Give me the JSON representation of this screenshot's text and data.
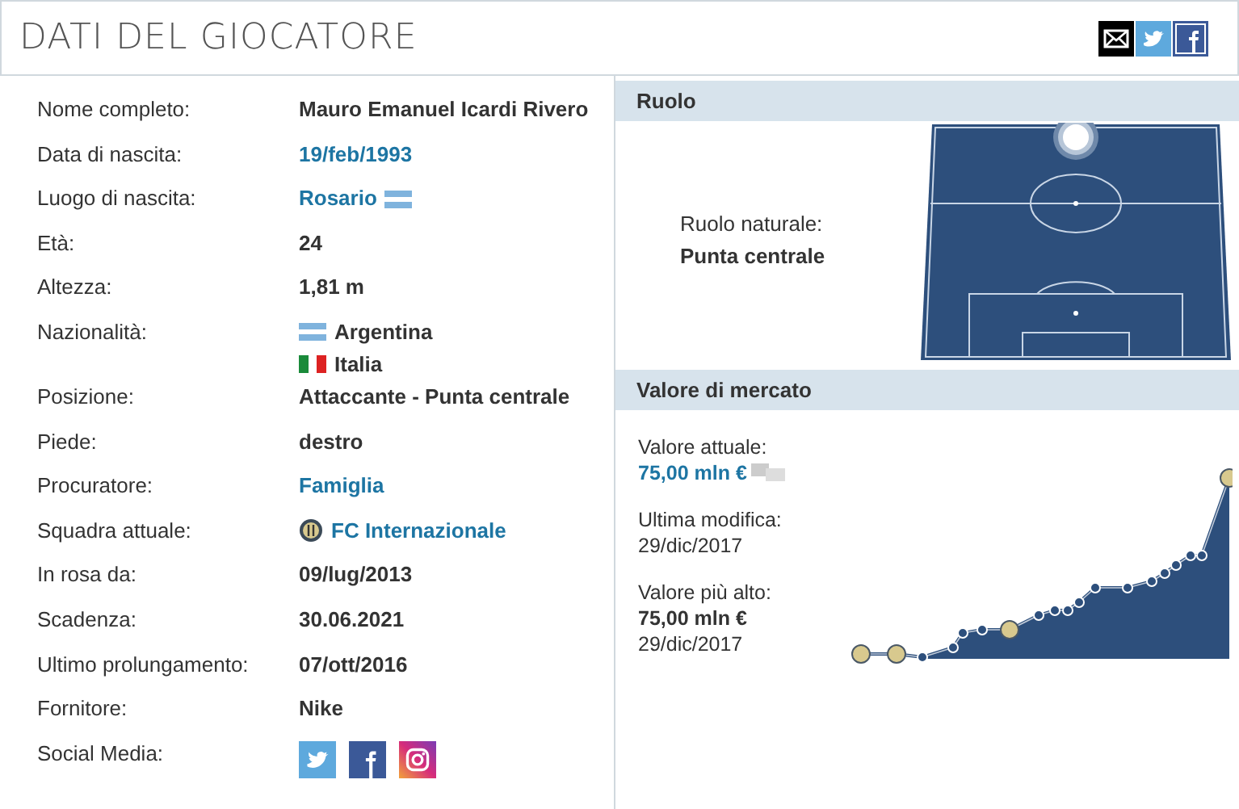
{
  "title": "DATI DEL GIOCATORE",
  "rows": [
    {
      "label": "Nome completo:",
      "values": [
        {
          "text": "Mauro Emanuel Icardi Rivero",
          "kind": "text"
        }
      ]
    },
    {
      "label": "Data di nascita:",
      "values": [
        {
          "text": "19/feb/1993",
          "kind": "link"
        }
      ]
    },
    {
      "label": "Luogo di nascita:",
      "values": [
        {
          "text": "Rosario",
          "kind": "link"
        }
      ]
    },
    {
      "label": "Età:",
      "values": [
        {
          "text": "24",
          "kind": "text"
        }
      ]
    },
    {
      "label": "Altezza:",
      "values": [
        {
          "text": "1,81 m",
          "kind": "text"
        }
      ]
    },
    {
      "label": "Nazionalità:",
      "values": [
        {
          "text": "Argentina",
          "kind": "text"
        },
        {
          "text": "Italia",
          "kind": "text"
        }
      ]
    },
    {
      "label": "Posizione:",
      "values": [
        {
          "text": "Attaccante - Punta centrale",
          "kind": "text"
        }
      ]
    },
    {
      "label": "Piede:",
      "values": [
        {
          "text": "destro",
          "kind": "text"
        }
      ]
    },
    {
      "label": "Procuratore:",
      "values": [
        {
          "text": "Famiglia",
          "kind": "link"
        }
      ]
    },
    {
      "label": "Squadra attuale:",
      "values": [
        {
          "text": "FC Internazionale",
          "kind": "link"
        }
      ]
    },
    {
      "label": "In rosa da:",
      "values": [
        {
          "text": "09/lug/2013",
          "kind": "text"
        }
      ]
    },
    {
      "label": "Scadenza:",
      "values": [
        {
          "text": "30.06.2021",
          "kind": "text"
        }
      ]
    },
    {
      "label": "Ultimo prolungamento:",
      "values": [
        {
          "text": "07/ott/2016",
          "kind": "text"
        }
      ]
    },
    {
      "label": "Fornitore:",
      "values": [
        {
          "text": "Nike",
          "kind": "text"
        }
      ]
    },
    {
      "label": "Social Media:",
      "values": [
        {
          "kind": "social"
        }
      ]
    }
  ],
  "ruolo": {
    "header": "Ruolo",
    "label": "Ruolo naturale:",
    "value": "Punta centrale"
  },
  "market": {
    "header": "Valore di mercato",
    "current_label": "Valore attuale:",
    "current_value": "75,00 mln €",
    "modified_label": "Ultima modifica:",
    "modified_date": "29/dic/2017",
    "highest_label": "Valore più alto:",
    "highest_value": "75,00 mln €",
    "highest_date": "29/dic/2017"
  }
}
